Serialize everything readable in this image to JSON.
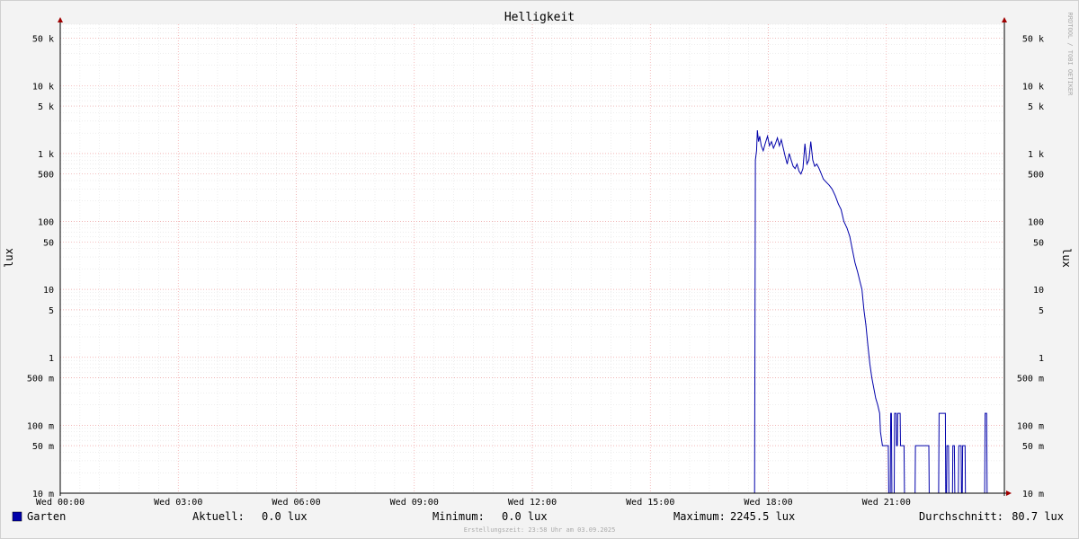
{
  "chart_data": {
    "type": "line",
    "title": "Helligkeit",
    "ylabel": "lux",
    "ylabel_right": "lux",
    "y_scale": "log",
    "ylim": [
      0.01,
      80000
    ],
    "xlim": [
      0,
      24
    ],
    "y_ticks": [
      {
        "value": 0.01,
        "label": "10 m"
      },
      {
        "value": 0.05,
        "label": "50 m"
      },
      {
        "value": 0.1,
        "label": "100 m"
      },
      {
        "value": 0.5,
        "label": "500 m"
      },
      {
        "value": 1,
        "label": "1"
      },
      {
        "value": 5,
        "label": "5"
      },
      {
        "value": 10,
        "label": "10"
      },
      {
        "value": 50,
        "label": "50"
      },
      {
        "value": 100,
        "label": "100"
      },
      {
        "value": 500,
        "label": "500"
      },
      {
        "value": 1000,
        "label": "1 k"
      },
      {
        "value": 5000,
        "label": "5 k"
      },
      {
        "value": 10000,
        "label": "10 k"
      },
      {
        "value": 50000,
        "label": "50 k"
      }
    ],
    "x_ticks": [
      {
        "value": 0,
        "label": "Wed 00:00"
      },
      {
        "value": 3,
        "label": "Wed 03:00"
      },
      {
        "value": 6,
        "label": "Wed 06:00"
      },
      {
        "value": 9,
        "label": "Wed 09:00"
      },
      {
        "value": 12,
        "label": "Wed 12:00"
      },
      {
        "value": 15,
        "label": "Wed 15:00"
      },
      {
        "value": 18,
        "label": "Wed 18:00"
      },
      {
        "value": 21,
        "label": "Wed 21:00"
      }
    ],
    "grid": true,
    "series": [
      {
        "name": "Garten",
        "color": "#0000aa",
        "x": [
          0,
          17.65,
          17.67,
          17.7,
          17.72,
          17.75,
          17.78,
          17.82,
          17.87,
          17.92,
          17.98,
          18.03,
          18.08,
          18.13,
          18.18,
          18.23,
          18.28,
          18.33,
          18.38,
          18.43,
          18.48,
          18.53,
          18.58,
          18.63,
          18.68,
          18.73,
          18.78,
          18.83,
          18.88,
          18.93,
          18.98,
          19.03,
          19.08,
          19.13,
          19.18,
          19.23,
          19.28,
          19.33,
          19.4,
          19.47,
          19.55,
          19.62,
          19.7,
          19.78,
          19.85,
          19.92,
          20.0,
          20.07,
          20.13,
          20.2,
          20.27,
          20.33,
          20.38,
          20.43,
          20.48,
          20.53,
          20.58,
          20.63,
          20.68,
          20.73,
          20.78,
          20.83,
          20.85,
          20.9,
          20.95,
          21.0,
          21.05,
          21.06,
          21.1,
          21.11,
          21.13,
          21.14,
          21.2,
          21.21,
          21.25,
          21.26,
          21.28,
          21.29,
          21.35,
          21.36,
          21.45,
          21.46,
          21.73,
          21.74,
          22.08,
          22.09,
          22.33,
          22.34,
          22.5,
          22.51,
          22.53,
          22.54,
          22.58,
          22.59,
          22.68,
          22.69,
          22.73,
          22.74,
          22.83,
          22.84,
          22.9,
          22.91,
          22.93,
          22.94,
          23.0,
          23.01,
          23.5,
          23.51,
          23.55,
          23.56,
          23.95
        ],
        "values": [
          0.01,
          0.01,
          800,
          1100,
          2200,
          1500,
          1800,
          1300,
          1100,
          1400,
          1800,
          1300,
          1500,
          1200,
          1400,
          1700,
          1300,
          1600,
          1200,
          900,
          700,
          1000,
          800,
          650,
          600,
          700,
          550,
          500,
          600,
          1400,
          700,
          800,
          1500,
          800,
          650,
          700,
          620,
          530,
          420,
          380,
          340,
          300,
          240,
          180,
          150,
          100,
          80,
          60,
          40,
          25,
          18,
          13,
          10,
          5,
          3,
          1.5,
          0.8,
          0.5,
          0.35,
          0.25,
          0.2,
          0.15,
          0.08,
          0.05,
          0.05,
          0.05,
          0.05,
          0.01,
          0.01,
          0.15,
          0.15,
          0.01,
          0.01,
          0.15,
          0.15,
          0.05,
          0.05,
          0.15,
          0.15,
          0.05,
          0.05,
          0.01,
          0.01,
          0.05,
          0.05,
          0.01,
          0.01,
          0.15,
          0.15,
          0.01,
          0.01,
          0.05,
          0.05,
          0.01,
          0.01,
          0.05,
          0.05,
          0.01,
          0.01,
          0.05,
          0.05,
          0.01,
          0.01,
          0.05,
          0.05,
          0.01,
          0.01,
          0.15,
          0.15,
          0.01,
          0.01
        ]
      }
    ]
  },
  "side_label": "RRDTOOL / TOBI OETIKER",
  "legend": {
    "name": "Garten",
    "color": "#0000aa",
    "current_label": "Aktuell:",
    "current_value": "0.0 lux",
    "min_label": "Minimum:",
    "min_value": "0.0 lux",
    "max_label": "Maximum:",
    "max_value": "2245.5 lux",
    "avg_label": "Durchschnitt:",
    "avg_value": "80.7 lux"
  },
  "footer": "Erstellungszeit: 23:58 Uhr am 03.09.2025"
}
